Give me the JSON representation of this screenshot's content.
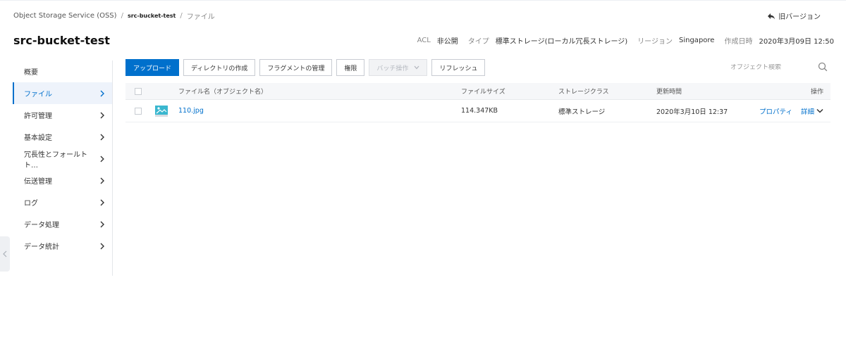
{
  "breadcrumb": {
    "root": "Object Storage Service (OSS)",
    "bucket": "src-bucket-test",
    "current": "ファイル"
  },
  "header": {
    "old_version": "旧バージョン",
    "bucket_title": "src-bucket-test",
    "acl_label": "ACL",
    "acl_value": "非公開",
    "type_label": "タイプ",
    "type_value": "標準ストレージ(ローカル冗長ストレージ)",
    "region_label": "リージョン",
    "region_value": "Singapore",
    "created_label": "作成日時",
    "created_value": "2020年3月09日 12:50"
  },
  "sidebar": {
    "items": [
      {
        "label": "概要"
      },
      {
        "label": "ファイル"
      },
      {
        "label": "許可管理"
      },
      {
        "label": "基本設定"
      },
      {
        "label": "冗長性とフォールトト…"
      },
      {
        "label": "伝送管理"
      },
      {
        "label": "ログ"
      },
      {
        "label": "データ処理"
      },
      {
        "label": "データ統計"
      }
    ]
  },
  "toolbar": {
    "upload": "アップロード",
    "create_dir": "ディレクトリの作成",
    "fragment": "フラグメントの管理",
    "permission": "権限",
    "batch": "バッチ操作",
    "refresh": "リフレッシュ"
  },
  "search": {
    "placeholder": "オブジェクト検索"
  },
  "table": {
    "headers": {
      "name": "ファイル名（オブジェクト名）",
      "size": "ファイルサイズ",
      "class": "ストレージクラス",
      "time": "更新時間",
      "ops": "操作"
    },
    "rows": [
      {
        "name": "110.jpg",
        "size": "114.347KB",
        "class": "標準ストレージ",
        "time": "2020年3月10日 12:37",
        "prop": "プロパティ",
        "detail": "詳細"
      }
    ]
  },
  "colors": {
    "accent": "#0070cc",
    "active_bg": "#eef3fb"
  }
}
